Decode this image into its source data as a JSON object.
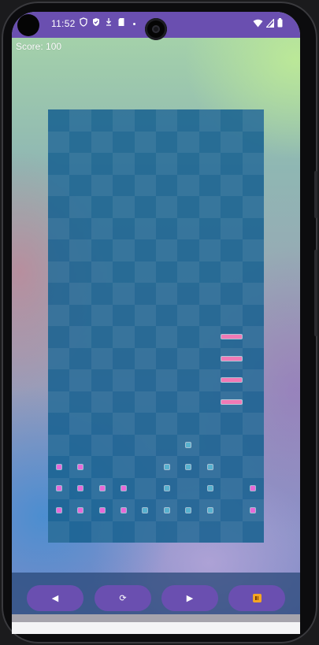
{
  "status_bar": {
    "time": "11:52",
    "left_icons": [
      "shield-icon",
      "shield-check-icon",
      "download-icon",
      "sd-card-icon",
      "dot-icon"
    ],
    "right_icons": [
      "wifi-icon",
      "signal-icon",
      "battery-icon"
    ]
  },
  "score": {
    "text": "Score: 100",
    "value": 100
  },
  "board": {
    "columns": 10,
    "rows": 20,
    "falling_piece": {
      "shape": "I",
      "orientation": "vertical",
      "color": "#f07ab5",
      "column": 8,
      "rows": [
        10,
        11,
        12,
        13
      ]
    },
    "settled_blocks": {
      "pink": {
        "color": "#e76ad8",
        "cells": [
          [
            16,
            0
          ],
          [
            16,
            1
          ],
          [
            17,
            0
          ],
          [
            17,
            1
          ],
          [
            17,
            2
          ],
          [
            17,
            3
          ],
          [
            17,
            9
          ],
          [
            18,
            0
          ],
          [
            18,
            1
          ],
          [
            18,
            2
          ],
          [
            18,
            3
          ],
          [
            18,
            9
          ]
        ]
      },
      "cyan": {
        "color": "#58b2cf",
        "cells": [
          [
            15,
            6
          ],
          [
            16,
            5
          ],
          [
            16,
            6
          ],
          [
            16,
            7
          ],
          [
            17,
            5
          ],
          [
            17,
            7
          ],
          [
            18,
            4
          ],
          [
            18,
            5
          ],
          [
            18,
            6
          ],
          [
            18,
            7
          ]
        ]
      }
    }
  },
  "controls": {
    "left_label": "◀",
    "rotate_label": "⟳",
    "right_label": "▶",
    "pause_icon": "pause-icon",
    "accent": "#6a4fb0"
  }
}
